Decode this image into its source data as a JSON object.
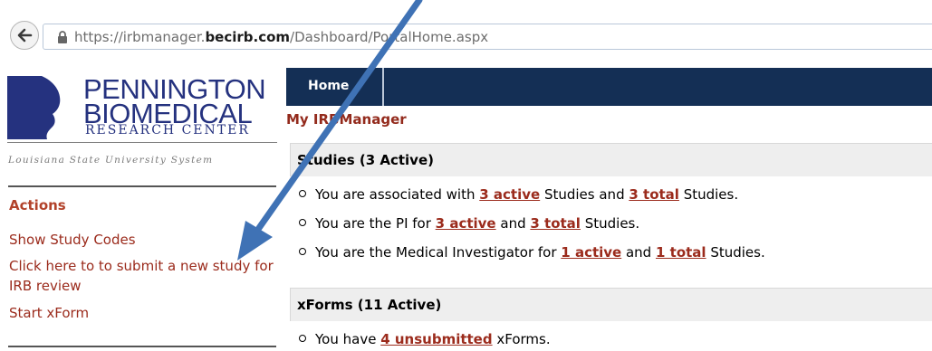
{
  "browser": {
    "url_prefix": "https://irbmanager.",
    "url_domain": "becirb.com",
    "url_path": "/Dashboard/PortalHome.aspx"
  },
  "logo": {
    "line1": "PENNINGTON",
    "line2": "BIOMEDICAL",
    "line3": "RESEARCH CENTER",
    "subtitle": "Louisiana State University System"
  },
  "sidebar": {
    "actions_title": "Actions",
    "items": [
      {
        "label": "Show Study Codes"
      },
      {
        "label": "Click here to to submit a new study for IRB review"
      },
      {
        "label": "Start xForm"
      }
    ]
  },
  "nav": {
    "tabs": [
      {
        "label": "Home"
      }
    ]
  },
  "main": {
    "title": "My IRBManager",
    "studies": {
      "header": "Studies (3 Active)",
      "lines": [
        {
          "pre": "You are associated with ",
          "link1": "3 active",
          "mid": " Studies and ",
          "link2": "3 total",
          "post": " Studies."
        },
        {
          "pre": "You are the PI for ",
          "link1": "3 active",
          "mid": " and ",
          "link2": "3 total",
          "post": " Studies."
        },
        {
          "pre": "You are the Medical Investigator for ",
          "link1": "1 active",
          "mid": " and ",
          "link2": "1 total",
          "post": " Studies."
        }
      ]
    },
    "xforms": {
      "header": "xForms (11 Active)",
      "lines": [
        {
          "pre": "You have ",
          "link1": "4 unsubmitted",
          "post": " xForms."
        }
      ]
    }
  },
  "colors": {
    "nav_bg": "#142f55",
    "link": "#9b2b1c",
    "arrow": "#3f72b5"
  },
  "icons": [
    "back-arrow-icon",
    "lock-icon",
    "logo-silhouette-icon",
    "annotation-arrow-icon"
  ]
}
